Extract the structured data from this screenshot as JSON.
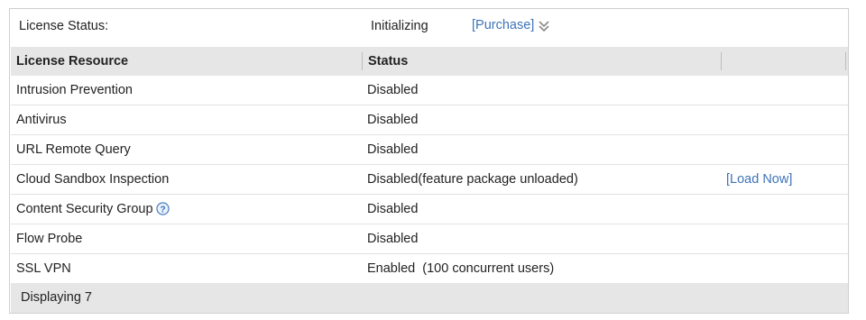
{
  "license_status": {
    "label": "License Status:",
    "value": "Initializing",
    "purchase_link": "[Purchase]",
    "expand_icon": "double-chevron-down-icon"
  },
  "table": {
    "headers": {
      "resource": "License Resource",
      "status": "Status",
      "action": ""
    },
    "rows": [
      {
        "resource": "Intrusion Prevention",
        "status": "Disabled",
        "action": ""
      },
      {
        "resource": "Antivirus",
        "status": "Disabled",
        "action": ""
      },
      {
        "resource": "URL Remote Query",
        "status": "Disabled",
        "action": ""
      },
      {
        "resource": "Cloud Sandbox Inspection",
        "status": "Disabled(feature package unloaded)",
        "action": "[Load Now]"
      },
      {
        "resource": "Content Security Group",
        "status": "Disabled",
        "action": "",
        "icon": "help-icon"
      },
      {
        "resource": "Flow Probe",
        "status": "Disabled",
        "action": ""
      },
      {
        "resource": "SSL VPN",
        "status": "Enabled  (100 concurrent users)",
        "action": ""
      }
    ]
  },
  "footer": {
    "text": "Displaying 7"
  },
  "colors": {
    "link": "#3d73b9",
    "header_bg": "#e6e6e6",
    "border": "#cfcfcf"
  }
}
